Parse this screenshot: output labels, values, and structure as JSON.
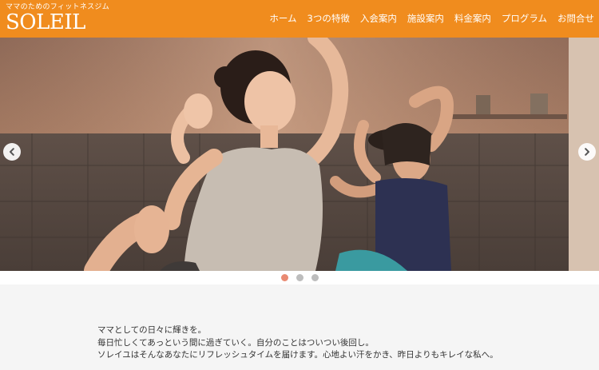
{
  "header": {
    "tagline": "ママのためのフィットネスジム",
    "brand": "SOLEIL",
    "accent": "#f08c1e"
  },
  "nav": {
    "items": [
      {
        "label": "ホーム"
      },
      {
        "label": "3つの特徴"
      },
      {
        "label": "入会案内"
      },
      {
        "label": "施設案内"
      },
      {
        "label": "料金案内"
      },
      {
        "label": "プログラム"
      },
      {
        "label": "お問合せ"
      }
    ]
  },
  "slider": {
    "prev_icon": "chevron-left-icon",
    "next_icon": "chevron-right-icon",
    "active_slide": 1,
    "slide_count": 3
  },
  "intro": {
    "lines": [
      "ママとしての日々に輝きを。",
      "毎日忙しくてあっという間に過ぎていく。自分のことはついつい後回し。",
      "ソレイユはそんなあなたにリフレッシュタイムを届けます。心地よい汗をかき、昨日よりもキレイな私へ。"
    ]
  }
}
